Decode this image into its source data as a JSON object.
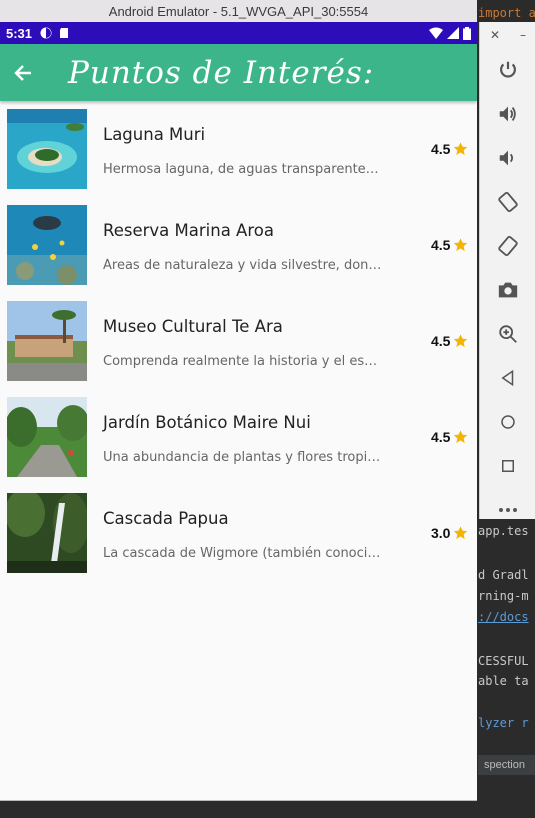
{
  "window": {
    "title": "Android Emulator - 5.1_WVGA_API_30:5554"
  },
  "status_bar": {
    "time": "5:31"
  },
  "app_bar": {
    "title": "Puntos de Interés:"
  },
  "colors": {
    "status_bar": "#2d0db9",
    "app_bar": "#3cb58a",
    "star": "#f4b400"
  },
  "places": [
    {
      "name": "Laguna Muri",
      "description": "Hermosa laguna, de aguas transparentes, …",
      "rating": "4.5"
    },
    {
      "name": "Reserva Marina Aroa",
      "description": "Áreas de naturaleza y vida silvestre, dond…",
      "rating": "4.5"
    },
    {
      "name": "Museo Cultural Te Ara",
      "description": "Comprenda realmente la historia y el espír…",
      "rating": "4.5"
    },
    {
      "name": "Jardín Botánico Maire Nui",
      "description": "Una abundancia de plantas y flores tropica…",
      "rating": "4.5"
    },
    {
      "name": "Cascada Papua",
      "description": "La cascada de Wigmore (también conocid…",
      "rating": "3.0"
    }
  ],
  "ide": {
    "lines": [
      "import a",
      "app.tes",
      "d Gradl",
      "rning-m",
      "://docs",
      "CESSFUL",
      "able ta",
      "lyzer r"
    ],
    "footer": "spection"
  }
}
